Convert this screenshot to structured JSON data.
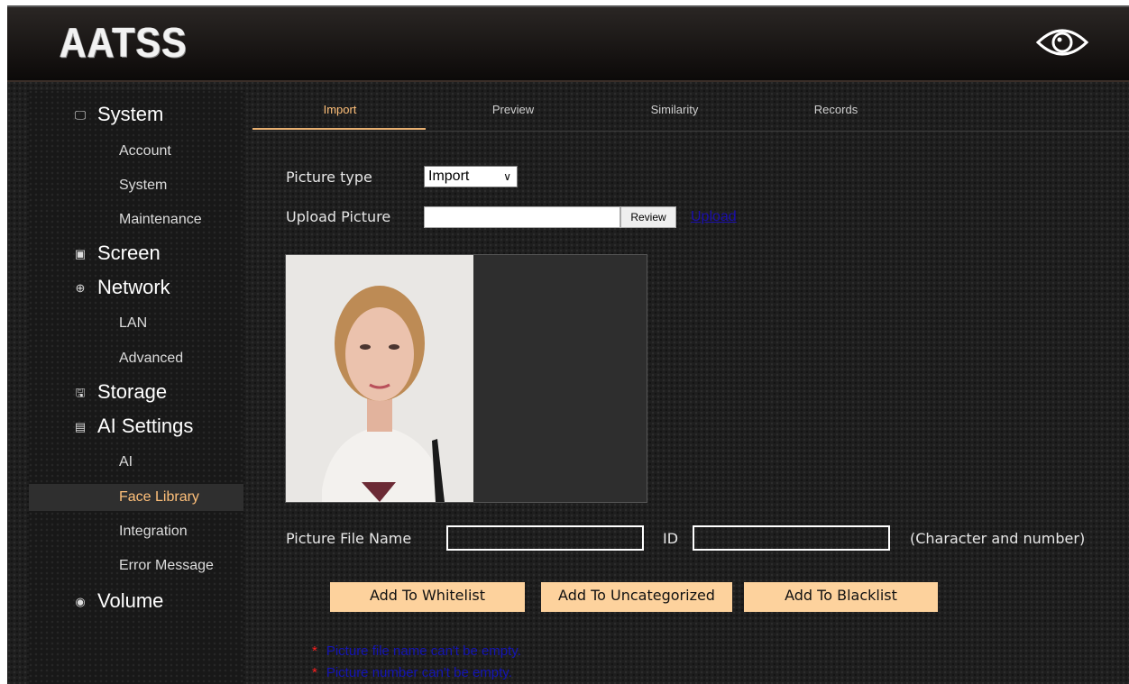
{
  "header": {
    "logo_text": "AATSS",
    "eye_icon": "eye-icon"
  },
  "sidebar": {
    "sections": [
      {
        "label": "System",
        "icon": "monitor-icon",
        "glyph": "🖵"
      },
      {
        "label": "Screen",
        "icon": "image-icon",
        "glyph": "▣"
      },
      {
        "label": "Network",
        "icon": "globe-icon",
        "glyph": "⊕"
      },
      {
        "label": "Storage",
        "icon": "save-icon",
        "glyph": "🖫"
      },
      {
        "label": "AI Settings",
        "icon": "chip-icon",
        "glyph": "▤"
      },
      {
        "label": "Volume",
        "icon": "speaker-icon",
        "glyph": "◉"
      }
    ],
    "items": {
      "account": "Account",
      "system": "System",
      "maintenance": "Maintenance",
      "lan": "LAN",
      "advanced": "Advanced",
      "ai": "AI",
      "face_library": "Face Library",
      "integration": "Integration",
      "error_message": "Error Message"
    },
    "active_item": "Face Library"
  },
  "tabs": [
    "Import",
    "Preview",
    "Similarity",
    "Records"
  ],
  "active_tab": "Import",
  "form": {
    "picture_type_label": "Picture type",
    "picture_type_value": "Import",
    "upload_label": "Upload Picture",
    "review_button": "Review",
    "upload_link": "Upload",
    "file_name_label": "Picture File Name",
    "id_label": "ID",
    "hint": "(Character and number)"
  },
  "buttons": {
    "whitelist": "Add To Whitelist",
    "uncategorized": "Add To Uncategorized",
    "blacklist": "Add To Blacklist"
  },
  "errors": {
    "star": "*",
    "file_name": "Picture file name can't be empty.",
    "number": "Picture number can't be empty."
  },
  "colors": {
    "accent": "#ffc07a",
    "button_bg": "#fdd29d",
    "error_star": "#ff2020",
    "error_text": "#1414b4"
  }
}
